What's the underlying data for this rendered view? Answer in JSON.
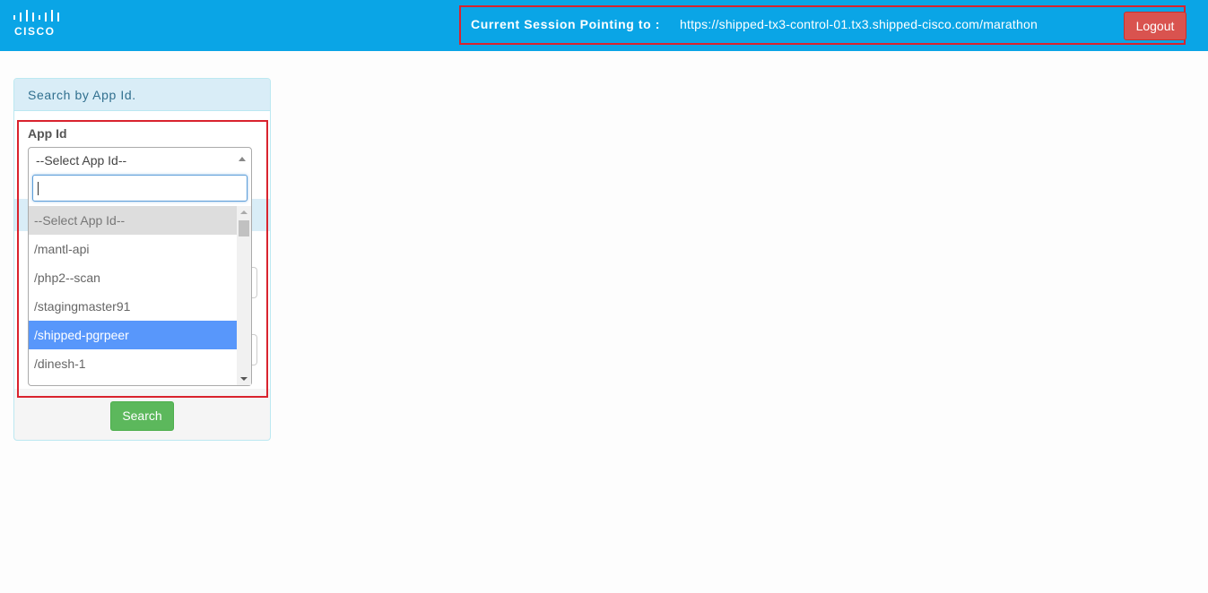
{
  "header": {
    "logo_text": "CISCO",
    "session_label": "Current Session Pointing to :",
    "session_url": "https://shipped-tx3-control-01.tx3.shipped-cisco.com/marathon",
    "logout_label": "Logout"
  },
  "search_panel": {
    "title": "Search by App Id.",
    "app_id_label": "App Id",
    "selected_value": "--Select App Id--",
    "dropdown_search_value": "",
    "options": [
      "--Select App Id--",
      "/mantl-api",
      "/php2--scan",
      "/stagingmaster91",
      "/shipped-pgrpeer",
      "/dinesh-1"
    ],
    "highlighted_option": "/shipped-pgrpeer",
    "search_button_label": "Search"
  },
  "colors": {
    "header_bg": "#0aa5e6",
    "annotation_border": "#d9232e",
    "logout_bg": "#d9534f",
    "search_bg": "#5cb85c",
    "option_highlight": "#5897fb"
  }
}
